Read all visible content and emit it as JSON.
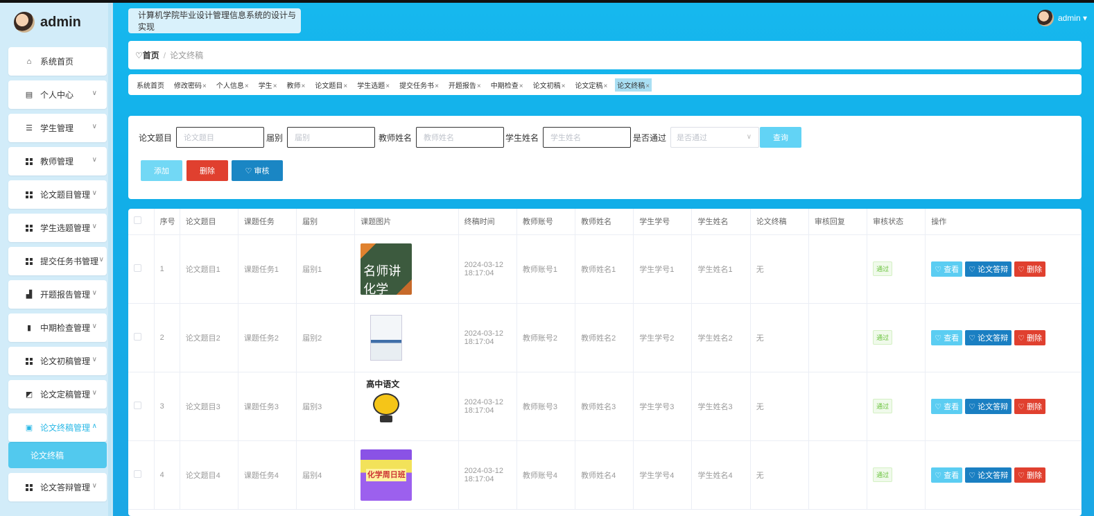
{
  "brand": {
    "name": "admin"
  },
  "sidebar": {
    "items": [
      {
        "label": "系统首页",
        "icon": "home-icon"
      },
      {
        "label": "个人中心",
        "icon": "profile-icon",
        "chevron": "∨"
      },
      {
        "label": "学生管理",
        "icon": "sliders-icon",
        "chevron": "∨"
      },
      {
        "label": "教师管理",
        "icon": "grid-icon",
        "chevron": "∨"
      },
      {
        "label": "论文题目管理",
        "icon": "grid-icon",
        "chevron": "∨"
      },
      {
        "label": "学生选题管理",
        "icon": "grid-icon",
        "chevron": "∨"
      },
      {
        "label": "提交任务书管理",
        "icon": "grid-icon",
        "chevron": "∨"
      },
      {
        "label": "开题报告管理",
        "icon": "projector-icon",
        "chevron": "∨"
      },
      {
        "label": "中期检查管理",
        "icon": "bar-chart-icon",
        "chevron": "∨"
      },
      {
        "label": "论文初稿管理",
        "icon": "grid-icon",
        "chevron": "∨"
      },
      {
        "label": "论文定稿管理",
        "icon": "line-chart-icon",
        "chevron": "∨"
      },
      {
        "label": "论文终稿管理",
        "icon": "clipboard-icon",
        "chevron": "∧"
      },
      {
        "label": "论文答辩管理",
        "icon": "grid-icon",
        "chevron": "∨"
      }
    ],
    "sub_item": "论文终稿"
  },
  "header": {
    "system_title": "计算机学院毕业设计管理信息系统的设计与实现",
    "user": "admin ▾"
  },
  "breadcrumb": {
    "home": "♡首页",
    "sep": "/",
    "current": "论文终稿"
  },
  "tags": [
    {
      "label": "系统首页",
      "close": ""
    },
    {
      "label": "修改密码",
      "close": "×"
    },
    {
      "label": "个人信息",
      "close": "×"
    },
    {
      "label": "学生",
      "close": "×"
    },
    {
      "label": "教师",
      "close": "×"
    },
    {
      "label": "论文题目",
      "close": "×"
    },
    {
      "label": "学生选题",
      "close": "×"
    },
    {
      "label": "提交任务书",
      "close": "×"
    },
    {
      "label": "开题报告",
      "close": "×"
    },
    {
      "label": "中期检查",
      "close": "×"
    },
    {
      "label": "论文初稿",
      "close": "×"
    },
    {
      "label": "论文定稿",
      "close": "×"
    },
    {
      "label": "论文终稿",
      "close": "×",
      "active": true
    }
  ],
  "search": {
    "fields": [
      {
        "label": "论文题目",
        "placeholder": "论文题目"
      },
      {
        "label": "届别",
        "placeholder": "届别"
      },
      {
        "label": "教师姓名",
        "placeholder": "教师姓名"
      },
      {
        "label": "学生姓名",
        "placeholder": "学生姓名"
      }
    ],
    "select": {
      "label": "是否通过",
      "placeholder": "是否通过",
      "arrow": "∨"
    },
    "query": "查询",
    "add": "添加",
    "delete": "删除",
    "audit": "♡ 审核"
  },
  "table": {
    "headers": [
      "",
      "序号",
      "论文题目",
      "课题任务",
      "届别",
      "课题图片",
      "终稿时间",
      "教师账号",
      "教师姓名",
      "学生学号",
      "学生姓名",
      "论文终稿",
      "审核回复",
      "审核状态",
      "操作"
    ],
    "rows": [
      {
        "no": "1",
        "title": "论文题目1",
        "task": "课题任务1",
        "grade": "届别1",
        "time": "2024-03-12 18:17:04",
        "t_acc": "教师账号1",
        "t_name": "教师姓名1",
        "s_no": "学生学号1",
        "s_name": "学生姓名1",
        "final": "无",
        "reply": "",
        "status": "通过",
        "img_text": "名师讲化学"
      },
      {
        "no": "2",
        "title": "论文题目2",
        "task": "课题任务2",
        "grade": "届别2",
        "time": "2024-03-12 18:17:04",
        "t_acc": "教师账号2",
        "t_name": "教师姓名2",
        "s_no": "学生学号2",
        "s_name": "学生姓名2",
        "final": "无",
        "reply": "",
        "status": "通过",
        "img_text": ""
      },
      {
        "no": "3",
        "title": "论文题目3",
        "task": "课题任务3",
        "grade": "届别3",
        "time": "2024-03-12 18:17:04",
        "t_acc": "教师账号3",
        "t_name": "教师姓名3",
        "s_no": "学生学号3",
        "s_name": "学生姓名3",
        "final": "无",
        "reply": "",
        "status": "通过",
        "img_text": "高中语文"
      },
      {
        "no": "4",
        "title": "论文题目4",
        "task": "课题任务4",
        "grade": "届别4",
        "time": "2024-03-12 18:17:04",
        "t_acc": "教师账号4",
        "t_name": "教师姓名4",
        "s_no": "学生学号4",
        "s_name": "学生姓名4",
        "final": "无",
        "reply": "",
        "status": "通过",
        "img_text": "化学周日班"
      }
    ],
    "ops": {
      "view": "♡ 查看",
      "defense": "♡ 论文答辩",
      "delete": "♡ 删除"
    }
  },
  "colors": {
    "accent": "#16b8ee",
    "danger": "#e0402f",
    "primary_dark": "#1a86c4",
    "light_btn": "#62d3f5"
  }
}
